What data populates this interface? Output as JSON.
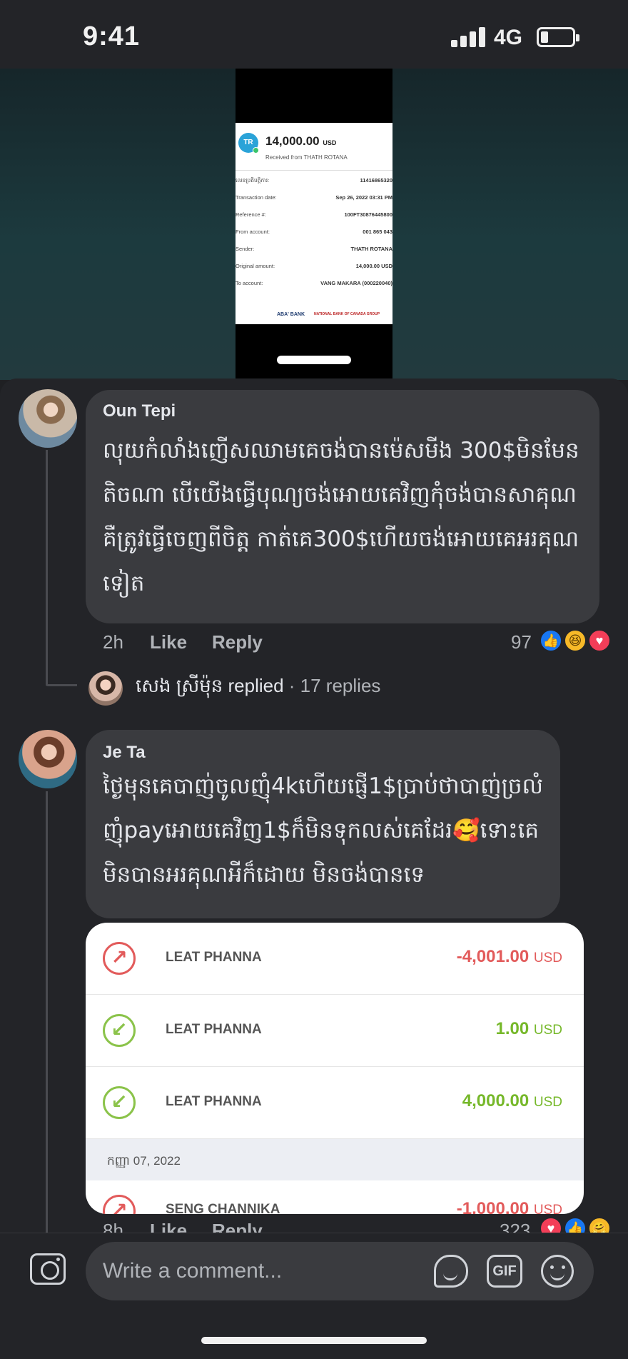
{
  "status": {
    "time": "9:41",
    "network": "4G"
  },
  "video": {
    "receipt": {
      "logo_initials": "TR",
      "amount": "14,000.00",
      "currency": "USD",
      "received_from": "Received from THATH ROTANA",
      "rows": [
        {
          "key": "លេខប្រតិបត្តិការ:",
          "value": "11416865320"
        },
        {
          "key": "Transaction date:",
          "value": "Sep 26, 2022 03:31 PM"
        },
        {
          "key": "Reference #:",
          "value": "100FT30876445800"
        },
        {
          "key": "From account:",
          "value": "001 865 043"
        },
        {
          "key": "Sender:",
          "value": "THATH ROTANA"
        },
        {
          "key": "Original amount:",
          "value": "14,000.00 USD"
        },
        {
          "key": "To account:",
          "value": "VANG MAKARA (000220040)"
        }
      ],
      "footer_bank": "ABA' BANK",
      "footer_nbc": "NATIONAL BANK OF CANADA GROUP"
    }
  },
  "comments": [
    {
      "author": "Oun Tepi",
      "lines": [
        "លុយកំលាំងញើសឈាមគេចង់បានម៉េសមីង 300$មិនមែន",
        "តិចណា បើយើងធ្វើបុណ្យចង់អោយគេវិញកុំចង់បានសាគុណ",
        "គឺត្រូវធ្វើចេញពីចិត្ត កាត់គេ300$ហើយចង់អោយគេអរគុណ",
        "ទៀត"
      ],
      "time": "2h",
      "like_label": "Like",
      "reply_label": "Reply",
      "reaction_count": "97",
      "replies": {
        "name": "សេង ស្រីម៉ុន",
        "action": "replied",
        "count": "· 17 replies"
      }
    },
    {
      "author": "Je Ta",
      "lines": [
        "ថ្ងៃមុនគេបាញ់ចូលញុំ4kហើយផ្ញើ1$ប្រាប់ថាបាញ់ច្រលំ",
        "ញុំpayអោយគេវិញ1$ក៏មិនទុកលស់គេដែរ🥰ទោះគេ",
        "មិនបានអរគុណអីក៏ដោយ មិនចង់បានទេ"
      ],
      "time": "8h",
      "like_label": "Like",
      "reply_label": "Reply",
      "reaction_count": "323"
    }
  ],
  "transactions": {
    "rows": [
      {
        "name": "LEAT PHANNA",
        "amount": "-4,001.00",
        "currency": "USD",
        "direction": "out"
      },
      {
        "name": "LEAT PHANNA",
        "amount": "1.00",
        "currency": "USD",
        "direction": "in"
      },
      {
        "name": "LEAT PHANNA",
        "amount": "4,000.00",
        "currency": "USD",
        "direction": "in"
      }
    ],
    "date_header": "កញ្ញា 07, 2022",
    "partial_row": {
      "name": "SENG CHANNIKA",
      "amount": "-1,000.00",
      "currency": "USD"
    }
  },
  "composer": {
    "placeholder": "Write a comment...",
    "gif_label": "GIF"
  },
  "icons": [
    "camera-icon",
    "sticker-icon",
    "gif-icon",
    "emoji-icon",
    "like-reaction-icon",
    "haha-reaction-icon",
    "love-reaction-icon",
    "care-reaction-icon",
    "arrow-up-right-icon",
    "arrow-down-left-icon"
  ],
  "colors": {
    "background": "#232428",
    "bubble": "#3a3b3f",
    "outgoing": "#e25b5b",
    "incoming": "#76b82a",
    "like": "#1877f2"
  }
}
